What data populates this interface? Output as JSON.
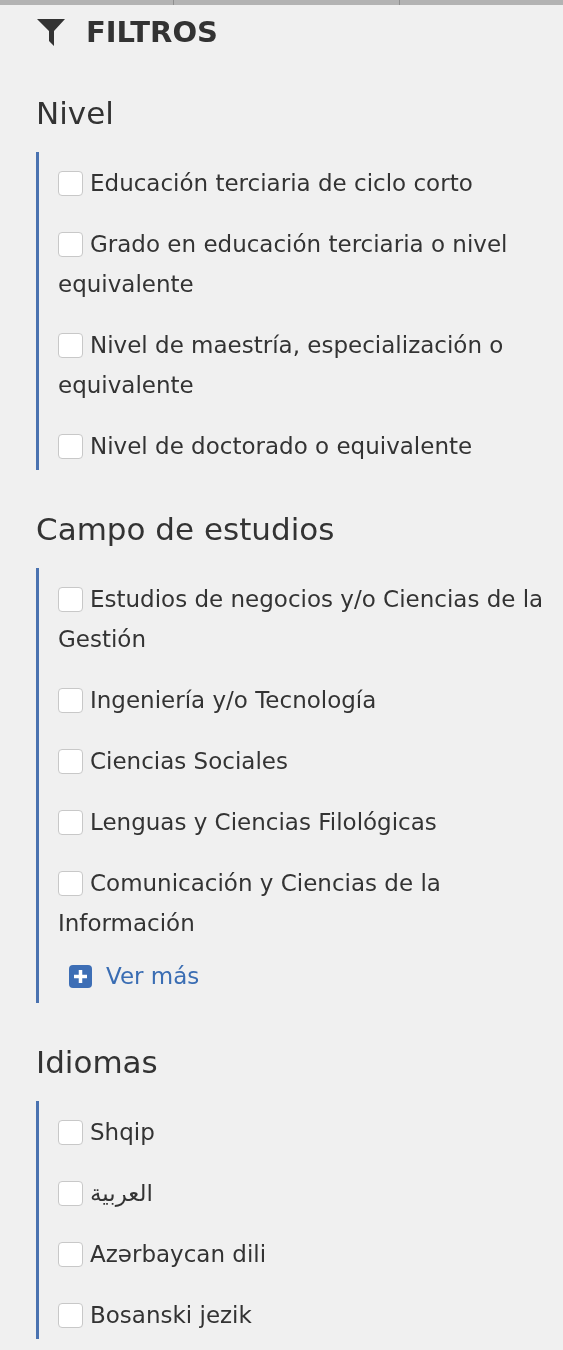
{
  "header": {
    "title": "FILTROS"
  },
  "sections": [
    {
      "title": "Nivel",
      "items": [
        {
          "label": "Educación terciaria de ciclo corto",
          "checked": false
        },
        {
          "label": "Grado en educación terciaria o nivel equivalente",
          "checked": false
        },
        {
          "label": "Nivel de maestría, especialización o equivalente",
          "checked": false
        },
        {
          "label": "Nivel de doctorado o equivalente",
          "checked": false
        }
      ]
    },
    {
      "title": "Campo de estudios",
      "items": [
        {
          "label": "Estudios de negocios y/o Ciencias de la Gestión",
          "checked": false
        },
        {
          "label": "Ingeniería y/o Tecnología",
          "checked": false
        },
        {
          "label": "Ciencias Sociales",
          "checked": false
        },
        {
          "label": "Lenguas y Ciencias Filológicas",
          "checked": false
        },
        {
          "label": "Comunicación y Ciencias de la Información",
          "checked": false
        }
      ],
      "more_link": "Ver más"
    },
    {
      "title": "Idiomas",
      "items": [
        {
          "label": "Shqip",
          "checked": false
        },
        {
          "label": "العربية",
          "checked": false
        },
        {
          "label": "Azərbaycan dili",
          "checked": false
        },
        {
          "label": "Bosanski jezik",
          "checked": false
        }
      ]
    }
  ]
}
